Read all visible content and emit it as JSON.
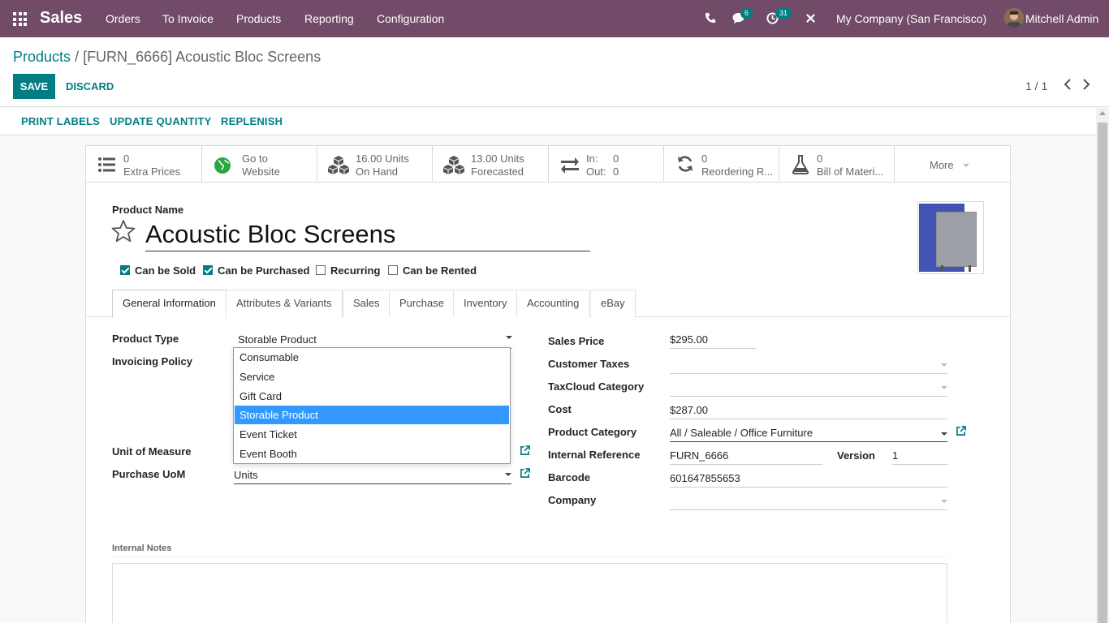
{
  "navbar": {
    "app_name": "Sales",
    "menu": [
      "Orders",
      "To Invoice",
      "Products",
      "Reporting",
      "Configuration"
    ],
    "messages_badge": "6",
    "activities_badge": "31",
    "company": "My Company (San Francisco)",
    "user": "Mitchell Admin",
    "color": "#714B67"
  },
  "control": {
    "breadcrumb_parent": "Products",
    "breadcrumb_current": "/ [FURN_6666] Acoustic Bloc Screens",
    "save_label": "SAVE",
    "discard_label": "DISCARD",
    "pager": "1 / 1"
  },
  "statusbar": {
    "buttons": [
      "PRINT LABELS",
      "UPDATE QUANTITY",
      "REPLENISH"
    ]
  },
  "smart_buttons": [
    {
      "value": "0",
      "label": "Extra Prices",
      "icon": "list-icon"
    },
    {
      "value": "Go to",
      "label": "Website",
      "icon": "globe-icon"
    },
    {
      "value": "16.00 Units",
      "label": "On Hand",
      "icon": "cubes-icon"
    },
    {
      "value": "13.00 Units",
      "label": "Forecasted",
      "icon": "cubes-icon"
    },
    {
      "value_in_label": "In:",
      "value_in": "0",
      "value_out_label": "Out:",
      "value_out": "0",
      "icon": "exchange-icon"
    },
    {
      "value": "0",
      "label": "Reordering R...",
      "icon": "refresh-icon"
    },
    {
      "value": "0",
      "label": "Bill of Materi...",
      "icon": "flask-icon"
    },
    {
      "label": "More"
    }
  ],
  "product": {
    "name_label": "Product Name",
    "name": "Acoustic Bloc Screens",
    "checkboxes": [
      {
        "label": "Can be Sold",
        "checked": true
      },
      {
        "label": "Can be Purchased",
        "checked": true
      },
      {
        "label": "Recurring",
        "checked": false
      },
      {
        "label": "Can be Rented",
        "checked": false
      }
    ]
  },
  "tabs": [
    "General Information",
    "Attributes & Variants",
    "Sales",
    "Purchase",
    "Inventory",
    "Accounting",
    "eBay"
  ],
  "left_fields": {
    "product_type_label": "Product Type",
    "product_type": "Storable Product",
    "invoicing_policy_label": "Invoicing Policy",
    "uom_label": "Unit of Measure",
    "purchase_uom_label": "Purchase UoM",
    "purchase_uom": "Units"
  },
  "dropdown_options": [
    "Consumable",
    "Service",
    "Gift Card",
    "Storable Product",
    "Event Ticket",
    "Event Booth"
  ],
  "dropdown_selected": "Storable Product",
  "right_fields": {
    "sales_price_label": "Sales Price",
    "sales_price": "$295.00",
    "customer_taxes_label": "Customer Taxes",
    "taxcloud_label": "TaxCloud Category",
    "cost_label": "Cost",
    "cost": "$287.00",
    "category_label": "Product Category",
    "category": "All / Saleable / Office Furniture",
    "internal_ref_label": "Internal Reference",
    "internal_ref": "FURN_6666",
    "version_label": "Version",
    "version": "1",
    "barcode_label": "Barcode",
    "barcode": "601647855653",
    "company_label": "Company"
  },
  "notes_label": "Internal Notes"
}
